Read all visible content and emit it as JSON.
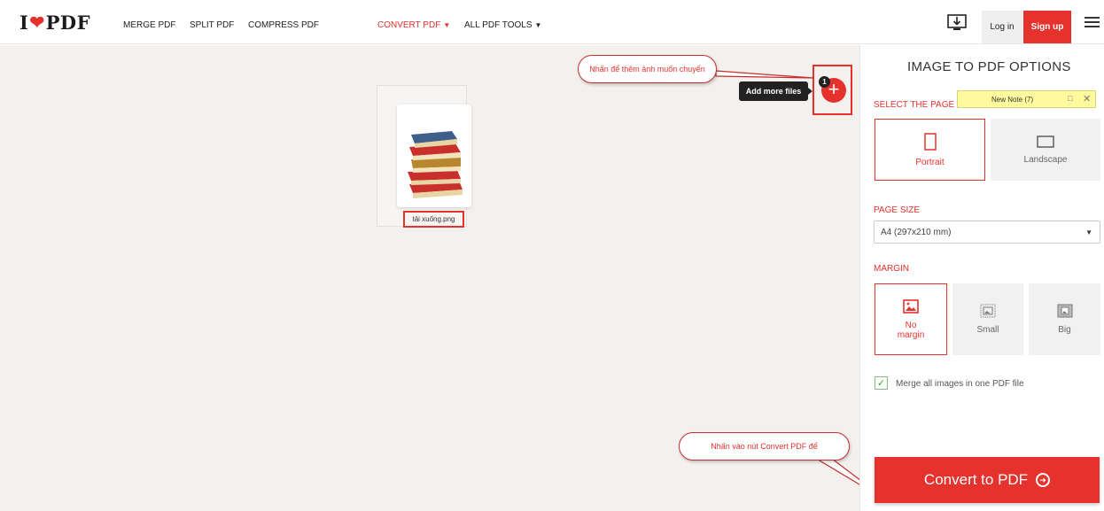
{
  "header": {
    "logo_left": "I",
    "logo_right": "PDF",
    "nav": [
      {
        "label": "MERGE PDF"
      },
      {
        "label": "SPLIT PDF"
      },
      {
        "label": "COMPRESS PDF"
      },
      {
        "label": "CONVERT PDF"
      },
      {
        "label": "ALL PDF TOOLS"
      }
    ],
    "login": "Log in",
    "signup": "Sign up"
  },
  "workspace": {
    "file_name": "tải xuống.png",
    "tooltip": "Add more files",
    "file_count": "1",
    "add_symbol": "+"
  },
  "annotations": {
    "callout_add": "Nhấn để thêm ảnh muốn chuyển",
    "callout_convert": "Nhấn vào nút Convert PDF để"
  },
  "sidebar": {
    "title": "IMAGE TO PDF OPTIONS",
    "orientation_label": "SELECT THE PAGE O",
    "orientation_options": [
      {
        "label": "Portrait",
        "selected": true
      },
      {
        "label": "Landscape",
        "selected": false
      }
    ],
    "page_size_label": "PAGE SIZE",
    "page_size_value": "A4 (297x210 mm)",
    "margin_label": "MARGIN",
    "margin_options": [
      {
        "label_line1": "No",
        "label_line2": "margin",
        "selected": true
      },
      {
        "label_line1": "Small",
        "selected": false
      },
      {
        "label_line1": "Big",
        "selected": false
      }
    ],
    "merge_label": "Merge all images in one PDF file",
    "merge_checked": true,
    "convert_label": "Convert to PDF"
  },
  "sticky_note": {
    "title": "New Note (7)"
  },
  "colors": {
    "brand": "#e5322d",
    "workspace_bg": "#f3f0ed",
    "note_bg": "#fffa9e"
  }
}
